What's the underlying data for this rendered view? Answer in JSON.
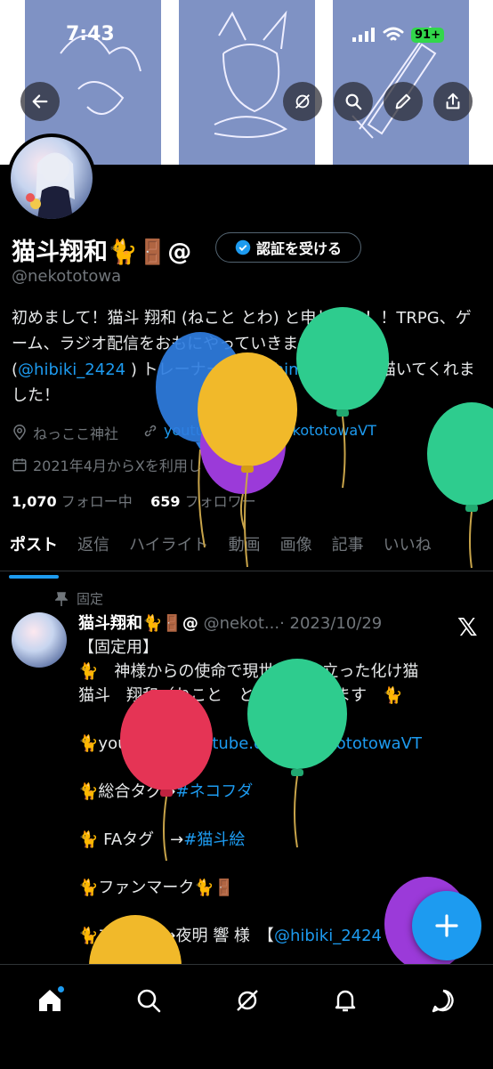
{
  "status_bar": {
    "time": "7:43",
    "battery": "91+"
  },
  "profile": {
    "display_name": "猫斗翔和🐈🚪@",
    "verify_button": "認証を受ける",
    "handle": "@nekototowa",
    "bio_1": "初めまして！猫斗 翔和 (ねこと とわ) と申します！！TRPG、ゲーム、ラジオ配信をおもにやっていきます！母上様 (",
    "bio_mention_1": "@hibiki_2424",
    "bio_2": " ) トレーナーは (",
    "bio_mention_2": "@shima_san_5",
    "bio_3": ") 描いてくれました！",
    "location": "ねっここ神社",
    "website": "youtube.com/c/nekototowaVT",
    "joined": "2021年4月からXを利用しています",
    "following_count": "1,070",
    "following_label": "フォロー中",
    "followers_count": "659",
    "followers_label": "フォロワー"
  },
  "tabs": [
    "ポスト",
    "返信",
    "ハイライト",
    "動画",
    "画像",
    "記事",
    "いいね"
  ],
  "pinned_post": {
    "pinned_label": "固定",
    "author": "猫斗翔和🐈🚪@",
    "handle": "@nekot...",
    "date": "· 2023/10/29",
    "line1": "【固定用】",
    "line2": "🐈　神様からの使命で現世に降り立った化け猫",
    "line3": "猫斗　翔和（ねこと　とわ）と申します　🐈",
    "line4_prefix": "🐈youtube →",
    "line4_link": "youtube.com/c/nekototowaVT",
    "line5_prefix": "🐈総合タグ→",
    "line5_link": "#ネコフダ",
    "line6_prefix": "🐈 FAタグ　→",
    "line6_link": "#猫斗絵",
    "line7": "🐈ファンマーク🐈🚪",
    "line8_prefix": "🐈ママ　　→夜明 響 様　【",
    "line8_link": "@hibiki_2424"
  },
  "icons": [
    "back-icon",
    "grok-icon",
    "search-icon",
    "edit-icon",
    "share-icon",
    "verified-icon",
    "location-icon",
    "link-icon",
    "calendar-icon",
    "pin-icon",
    "x-logo-icon",
    "home-icon",
    "search-nav-icon",
    "grok-nav-icon",
    "bell-icon",
    "messages-icon",
    "plus-icon"
  ],
  "colors": {
    "accent": "#1d9bf0",
    "banner": "#7f92c4",
    "muted": "#71767b",
    "battery": "#32d74b"
  }
}
